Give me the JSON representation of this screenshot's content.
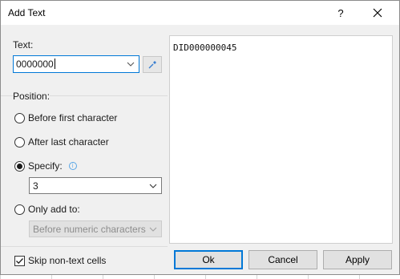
{
  "dialog": {
    "title": "Add Text",
    "help_label": "?"
  },
  "text_field": {
    "label": "Text:",
    "value": "0000000"
  },
  "position": {
    "label": "Position:",
    "options": [
      {
        "label": "Before first character",
        "checked": false
      },
      {
        "label": "After last character",
        "checked": false
      },
      {
        "label": "Specify:",
        "checked": true
      },
      {
        "label": "Only add to:",
        "checked": false
      }
    ],
    "specify_value": "3",
    "only_add_to_value": "Before numeric characters"
  },
  "preview": {
    "lines": [
      "DID000000045"
    ]
  },
  "skip_non_text": {
    "label": "Skip non-text cells",
    "checked": true
  },
  "buttons": {
    "ok": "Ok",
    "cancel": "Cancel",
    "apply": "Apply"
  },
  "colors": {
    "accent": "#0078d7",
    "dialog_bg": "#f0f0f0"
  }
}
